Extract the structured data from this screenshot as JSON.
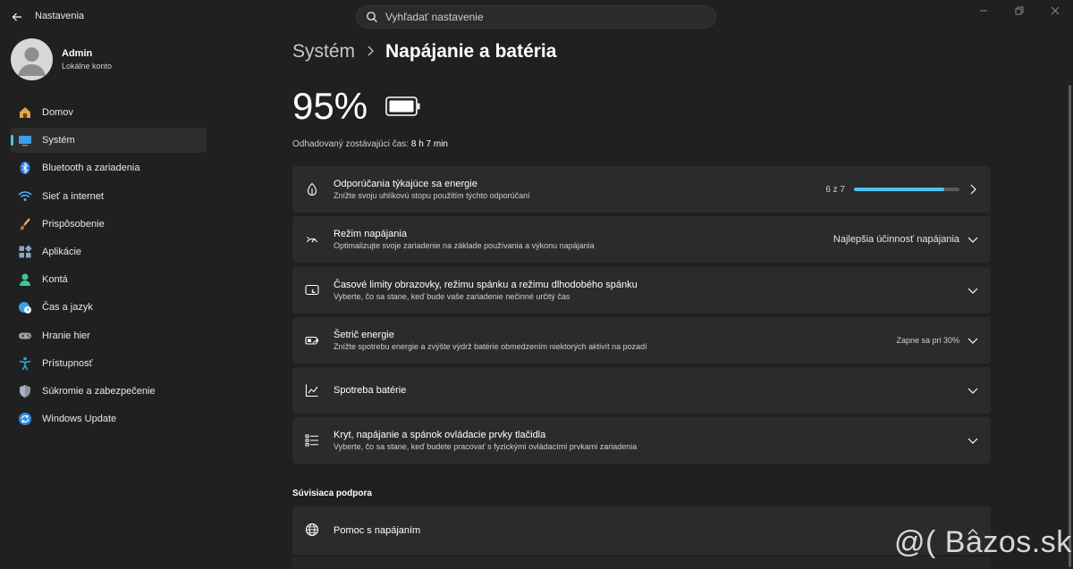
{
  "titlebar": {
    "app_title": "Nastavenia",
    "search_placeholder": "Vyhľadať nastavenie"
  },
  "profile": {
    "name": "Admin",
    "account": "Lokálne konto"
  },
  "sidebar": {
    "items": [
      {
        "label": "Domov",
        "icon": "home-icon"
      },
      {
        "label": "Systém",
        "icon": "system-icon",
        "active": true
      },
      {
        "label": "Bluetooth a zariadenia",
        "icon": "bluetooth-icon"
      },
      {
        "label": "Sieť a internet",
        "icon": "wifi-icon"
      },
      {
        "label": "Prispôsobenie",
        "icon": "brush-icon"
      },
      {
        "label": "Aplikácie",
        "icon": "apps-icon"
      },
      {
        "label": "Kontá",
        "icon": "account-icon"
      },
      {
        "label": "Čas a jazyk",
        "icon": "globe-clock-icon"
      },
      {
        "label": "Hranie hier",
        "icon": "gamepad-icon"
      },
      {
        "label": "Prístupnosť",
        "icon": "accessibility-icon"
      },
      {
        "label": "Súkromie a zabezpečenie",
        "icon": "shield-icon"
      },
      {
        "label": "Windows Update",
        "icon": "update-icon"
      }
    ]
  },
  "breadcrumb": {
    "parent": "Systém",
    "current": "Napájanie a batéria"
  },
  "battery": {
    "percent": "95%",
    "remaining_label": "Odhadovaný zostávajúci čas:",
    "remaining_value": "8 h 7 min"
  },
  "cards": [
    {
      "title": "Odporúčania týkajúce sa energie",
      "subtitle": "Znížte svoju uhlíkovú stopu použitím týchto odporúčaní",
      "right": "6 z 7",
      "progress": 0.857,
      "icon": "leaf-icon",
      "chevron": "chevron-right-icon"
    },
    {
      "title": "Režim napájania",
      "subtitle": "Optimalizujte svoje zariadenie na základe používania a výkonu napájania",
      "right": "Najlepšia účinnosť napájania",
      "icon": "power-mode-icon",
      "chevron": "chevron-down-icon"
    },
    {
      "title": "Časové limity obrazovky, režimu spánku a režimu dlhodobého spánku",
      "subtitle": "Vyberte, čo sa stane, keď bude vaše zariadenie nečinné určitý čas",
      "right": "",
      "icon": "screen-sleep-icon",
      "chevron": "chevron-down-icon"
    },
    {
      "title": "Šetrič energie",
      "subtitle": "Znížte spotrebu energie a zvýšte výdrž batérie obmedzením niektorých aktivít na pozadí",
      "right": "Zapne sa pri 30%",
      "icon": "battery-saver-icon",
      "chevron": "chevron-down-icon"
    },
    {
      "title": "Spotreba batérie",
      "subtitle": "",
      "right": "",
      "icon": "chart-icon",
      "chevron": "chevron-down-icon"
    },
    {
      "title": "Kryt, napájanie a spánok ovládacie prvky tlačidla",
      "subtitle": "Vyberte, čo sa stane, keď budete pracovať s fyzickými ovládacími prvkami zariadenia",
      "right": "",
      "icon": "list-icon",
      "chevron": "chevron-down-icon"
    }
  ],
  "related": {
    "section_title": "Súvisiaca podpora",
    "help_title": "Pomoc s napájaním"
  },
  "watermark": "@( Bazos.sk",
  "colors": {
    "background": "#202020",
    "card": "#2b2b2b",
    "accent": "#4cc2ff"
  }
}
